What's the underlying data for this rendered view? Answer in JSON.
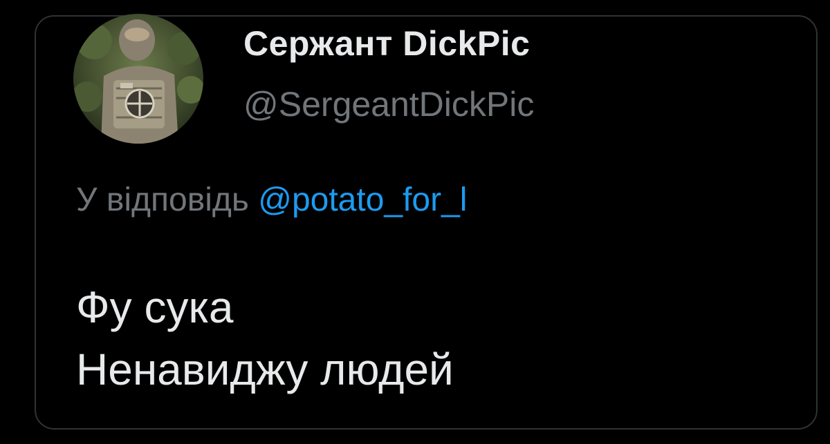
{
  "tweet": {
    "author": {
      "display_name": "Сержант DіckPіc",
      "handle": "@SergeantDickPic",
      "avatar": "avatar-photo"
    },
    "reply_prefix": "У відповідь",
    "reply_to": "@potato_for_l",
    "text_lines": [
      "Фу сука",
      "Ненавиджу людей"
    ]
  },
  "colors": {
    "background": "#000000",
    "border": "#2f3336",
    "primary_text": "#e7e9ea",
    "secondary_text": "#71767b",
    "link": "#1d9bf0"
  }
}
